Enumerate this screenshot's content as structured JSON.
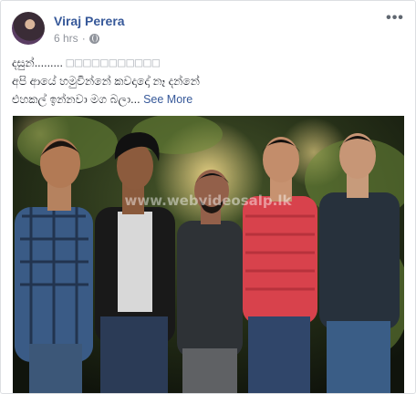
{
  "post": {
    "author": "Viraj Perera",
    "time": "6 hrs",
    "time_sep": "·",
    "more_glyph": "•••",
    "text_line1": "දසුන්.........",
    "text_boxes": "□□□□□□□□□□□",
    "text_line2": "අපි ආයේ හමුවින්නේ කවදාදෝ නෑ දන්නේ",
    "text_line3": "එහකල් ඉන්නවා මග බලා...",
    "see_more": "See More"
  },
  "photo": {
    "watermark": "www.webvideosalp.lk"
  },
  "colors": {
    "author_link": "#365899",
    "meta_text": "#90949c",
    "border": "#dddfe2"
  },
  "icons": [
    "globe-icon",
    "more-options-icon"
  ]
}
